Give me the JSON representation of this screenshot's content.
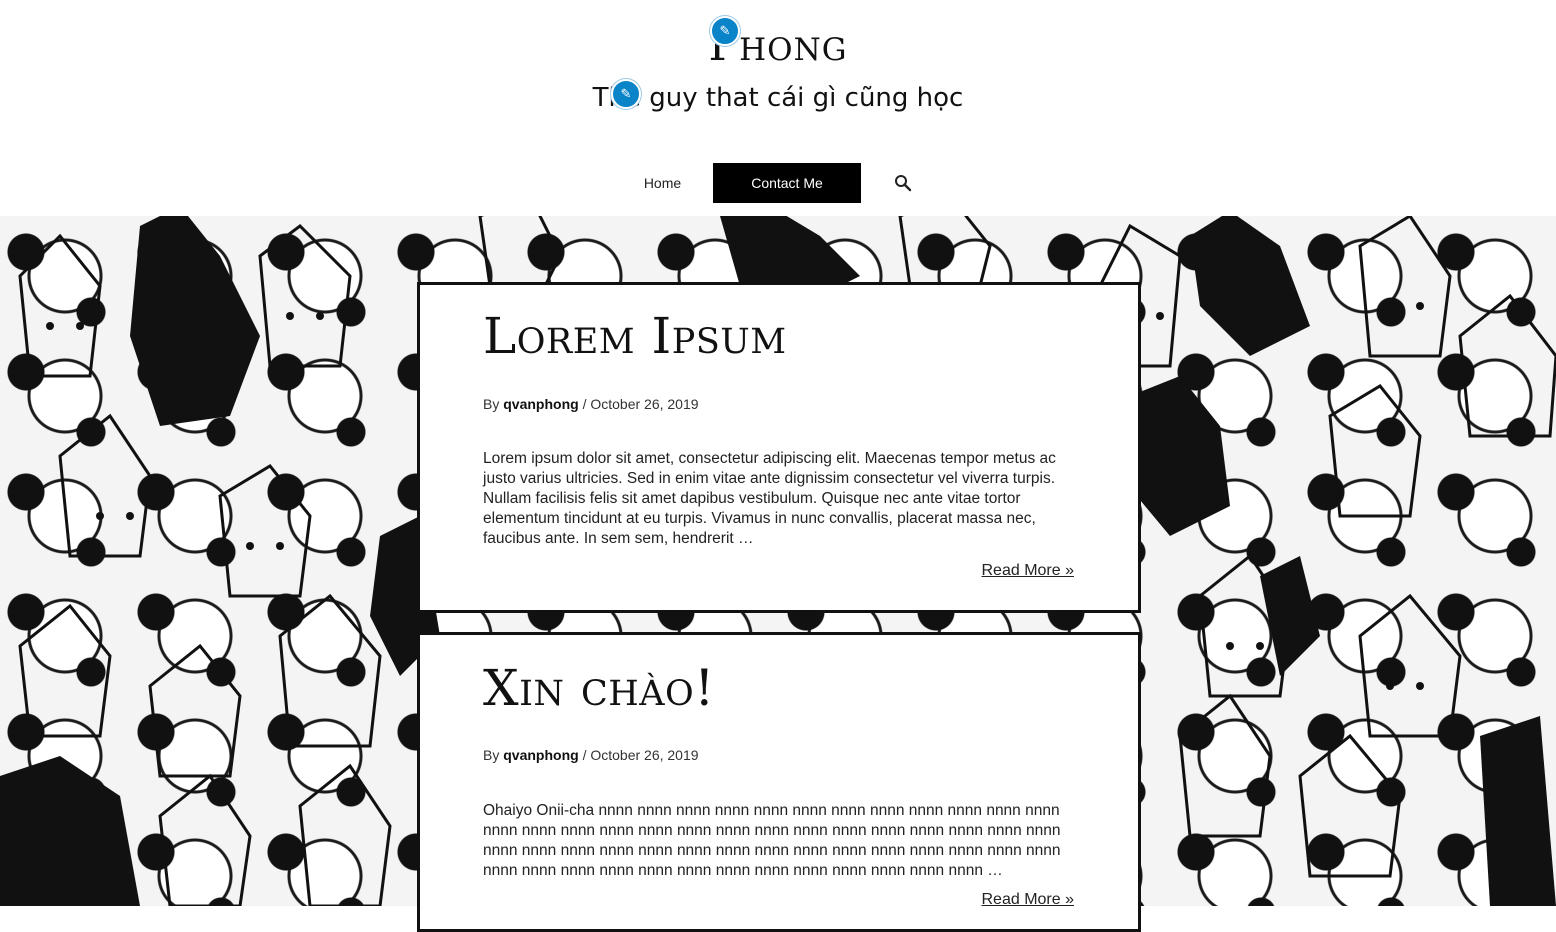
{
  "site": {
    "title": "Phong",
    "tagline": "The guy that cái gì cũng học"
  },
  "nav": {
    "items": [
      {
        "label": "Home"
      },
      {
        "label": "Contact Me"
      }
    ],
    "search_icon": "search-icon"
  },
  "posts": [
    {
      "title": "Lorem Ipsum",
      "by": "By",
      "author": "qvanphong",
      "separator": "/",
      "date": "October 26, 2019",
      "excerpt": "Lorem ipsum dolor sit amet, consectetur adipiscing elit. Maecenas tempor metus ac justo varius ultricies. Sed in enim vitae ante dignissim consectetur vel viverra turpis. Nullam facilisis felis sit amet dapibus vestibulum. Quisque nec ante vitae tortor elementum tincidunt at eu turpis. Vivamus in nunc convallis, placerat massa nec, faucibus ante. In sem sem, hendrerit …",
      "read_more": "Read More »"
    },
    {
      "title": "Xin chào!",
      "by": "By",
      "author": "qvanphong",
      "separator": "/",
      "date": "October 26, 2019",
      "excerpt": "Ohaiyo Onii-cha nnnn nnnn nnnn nnnn nnnn nnnn nnnn nnnn nnnn nnnn nnnn nnnn nnnn nnnn nnnn nnnn nnnn nnnn nnnn nnnn nnnn nnnn nnnn nnnn nnnn nnnn nnnn nnnn nnnn nnnn nnnn nnnn nnnn nnnn nnnn nnnn nnnn nnnn nnnn nnnn nnnn nnnn nnnn nnnn nnnn nnnn nnnn nnnn nnnn nnnn nnnn nnnn nnnn nnnn nnnn …",
      "read_more": "Read More »"
    }
  ],
  "colors": {
    "edit_badge": "#0a84c9",
    "nav_active_bg": "#000000",
    "card_border": "#111111"
  }
}
